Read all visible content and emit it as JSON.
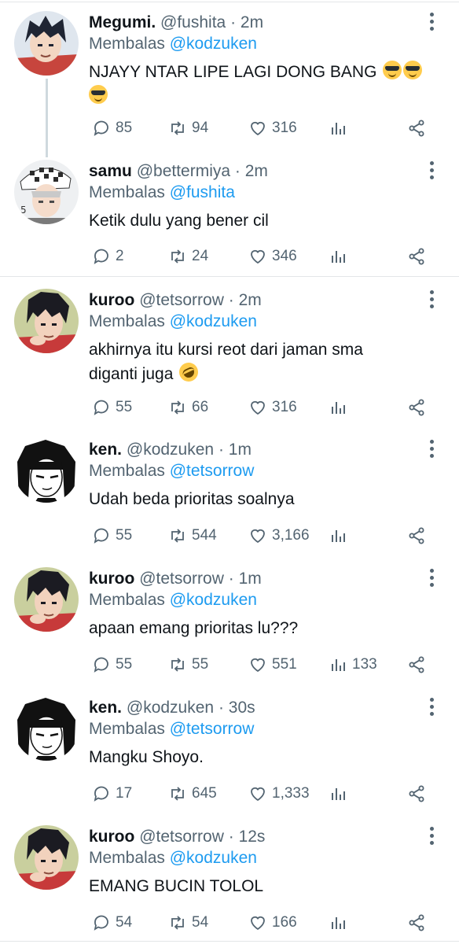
{
  "tweets": [
    {
      "name": "Megumi.",
      "handle": "@fushita",
      "time": "2m",
      "reply_prefix": "Membalas",
      "reply_to": "@kodzuken",
      "text": "NJAYY NTAR LIPE LAGI DONG BANG",
      "emoji": "smiling-face-with-sunglasses x3",
      "replies": "85",
      "retweets": "94",
      "likes": "316",
      "views": ""
    },
    {
      "name": "samu",
      "handle": "@bettermiya",
      "time": "2m",
      "reply_prefix": "Membalas",
      "reply_to": "@fushita",
      "text": "Ketik dulu yang bener cil",
      "replies": "2",
      "retweets": "24",
      "likes": "346",
      "views": ""
    },
    {
      "name": "kuroo",
      "handle": "@tetsorrow",
      "time": "2m",
      "reply_prefix": "Membalas",
      "reply_to": "@kodzuken",
      "text_line1": "akhirnya itu kursi reot dari jaman sma",
      "text_line2": "diganti juga",
      "emoji": "rolling-on-the-floor-laughing",
      "replies": "55",
      "retweets": "66",
      "likes": "316",
      "views": ""
    },
    {
      "name": "ken.",
      "handle": "@kodzuken",
      "time": "1m",
      "reply_prefix": "Membalas",
      "reply_to": "@tetsorrow",
      "text": "Udah beda prioritas soalnya",
      "replies": "55",
      "retweets": "544",
      "likes": "3,166",
      "views": ""
    },
    {
      "name": "kuroo",
      "handle": "@tetsorrow",
      "time": "1m",
      "reply_prefix": "Membalas",
      "reply_to": "@kodzuken",
      "text": "apaan emang prioritas lu???",
      "replies": "55",
      "retweets": "55",
      "likes": "551",
      "views": "133"
    },
    {
      "name": "ken.",
      "handle": "@kodzuken",
      "time": "30s",
      "reply_prefix": "Membalas",
      "reply_to": "@tetsorrow",
      "text": "Mangku Shoyo.",
      "replies": "17",
      "retweets": "645",
      "likes": "1,333",
      "views": ""
    },
    {
      "name": "kuroo",
      "handle": "@tetsorrow",
      "time": "12s",
      "reply_prefix": "Membalas",
      "reply_to": "@kodzuken",
      "text": "EMANG BUCIN TOLOL",
      "replies": "54",
      "retweets": "54",
      "likes": "166",
      "views": ""
    }
  ],
  "separator": "·",
  "icons": [
    "reply-icon",
    "retweet-icon",
    "like-icon",
    "views-icon",
    "share-icon",
    "more-options-icon"
  ],
  "colors": {
    "text": "#0f1419",
    "muted": "#536471",
    "mention": "#1d9bf0",
    "thread_line": "#cfd9de"
  }
}
